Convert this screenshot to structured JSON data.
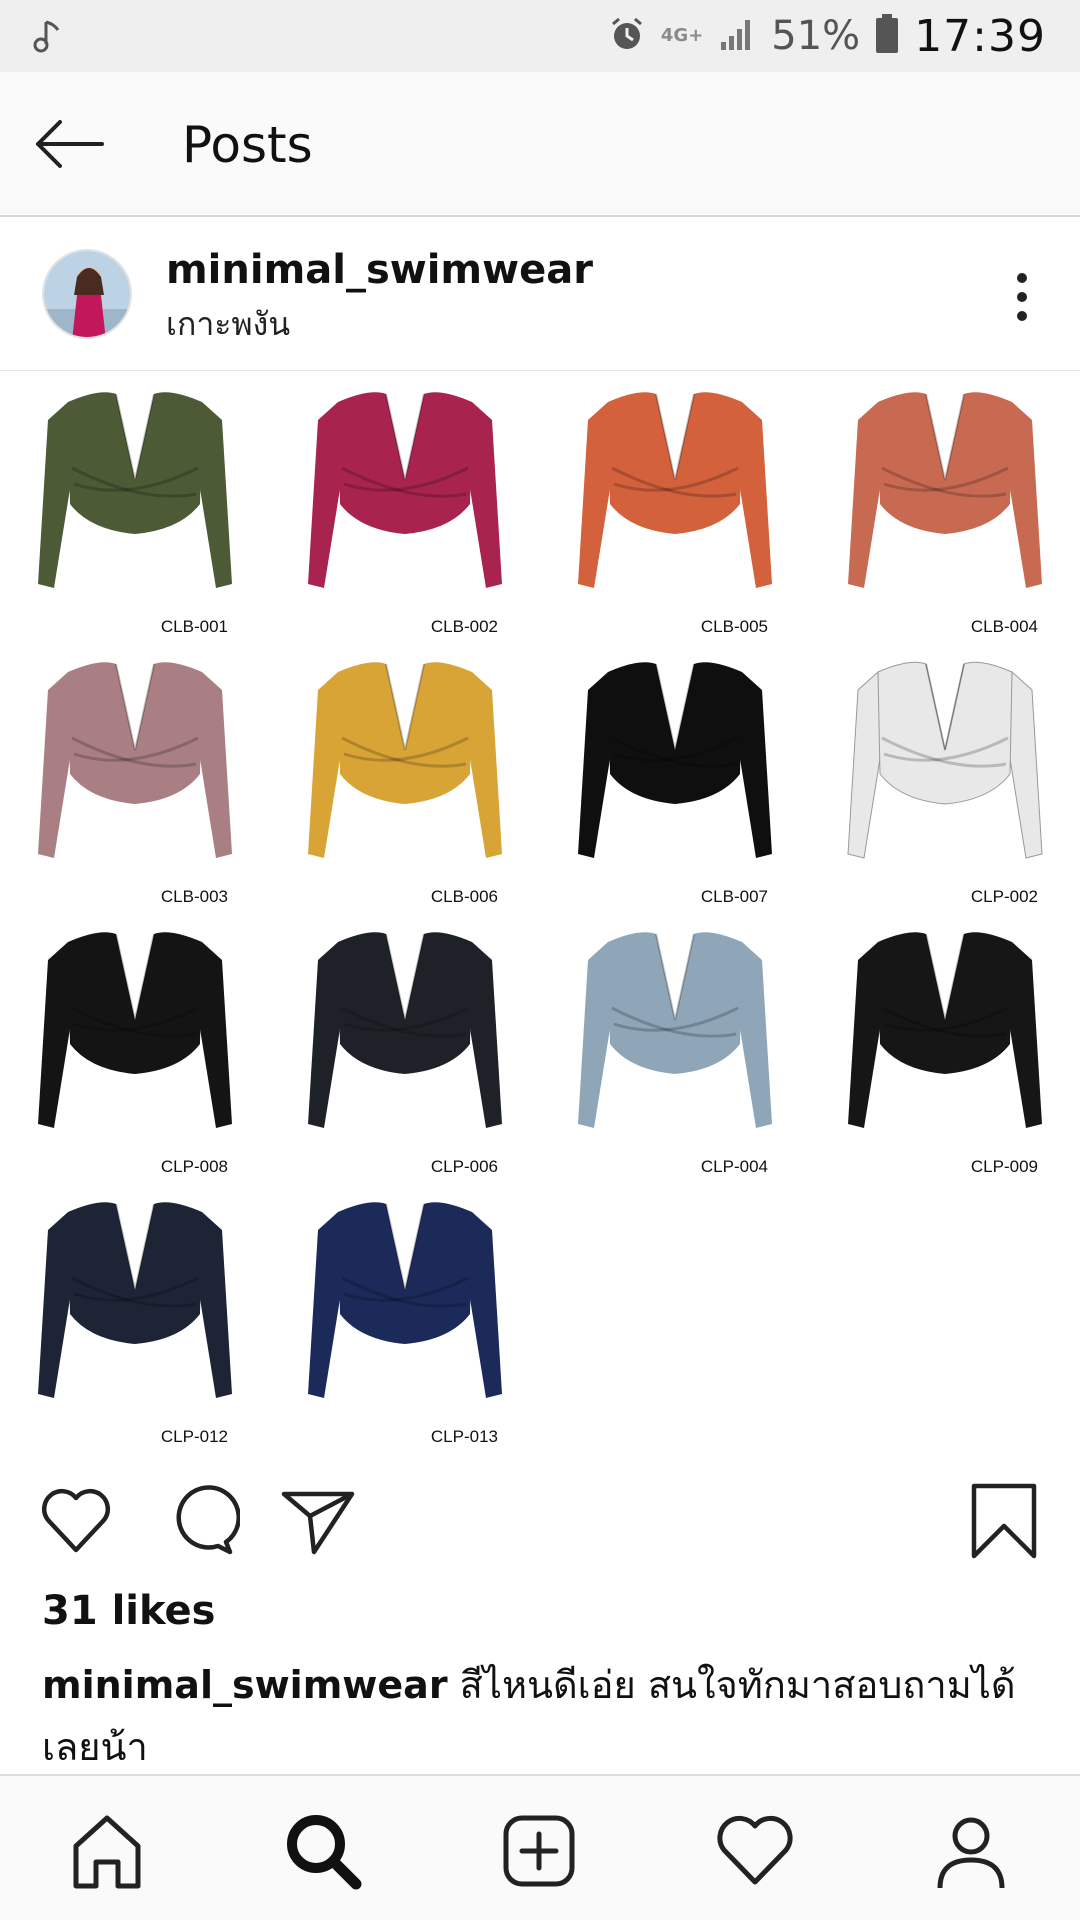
{
  "status_bar": {
    "network": "4G+",
    "battery": "51%",
    "time": "17:39"
  },
  "app_bar": {
    "title": "Posts"
  },
  "post": {
    "username": "minimal_swimwear",
    "location": "เกาะพงัน",
    "likes": "31 likes",
    "caption_user": "minimal_swimwear",
    "caption_text": " สีไหนดีเอ่ย สนใจทักมาสอบถามได้เลยน้า",
    "items": [
      {
        "code": "CLB-001",
        "color": "#4c5a36"
      },
      {
        "code": "CLB-002",
        "color": "#a8234e"
      },
      {
        "code": "CLB-005",
        "color": "#d2613c"
      },
      {
        "code": "CLB-004",
        "color": "#c86a52"
      },
      {
        "code": "CLB-003",
        "color": "#a97f83"
      },
      {
        "code": "CLB-006",
        "color": "#d9a436"
      },
      {
        "code": "CLB-007",
        "color": "#0f0f0f"
      },
      {
        "code": "CLP-002",
        "color": "#e8e8e8"
      },
      {
        "code": "CLP-008",
        "color": "#141414"
      },
      {
        "code": "CLP-006",
        "color": "#1e2228"
      },
      {
        "code": "CLP-004",
        "color": "#8fa6b8"
      },
      {
        "code": "CLP-009",
        "color": "#161616"
      },
      {
        "code": "CLP-012",
        "color": "#1c2436"
      },
      {
        "code": "CLP-013",
        "color": "#1c2a5a"
      }
    ]
  },
  "icons": {
    "status": [
      "music-note-icon",
      "alarm-icon",
      "signal-icon",
      "battery-icon"
    ],
    "actions": [
      "heart-icon",
      "comment-icon",
      "send-icon",
      "bookmark-icon"
    ],
    "nav": [
      "home-icon",
      "search-icon",
      "add-post-icon",
      "activity-heart-icon",
      "profile-icon"
    ]
  }
}
